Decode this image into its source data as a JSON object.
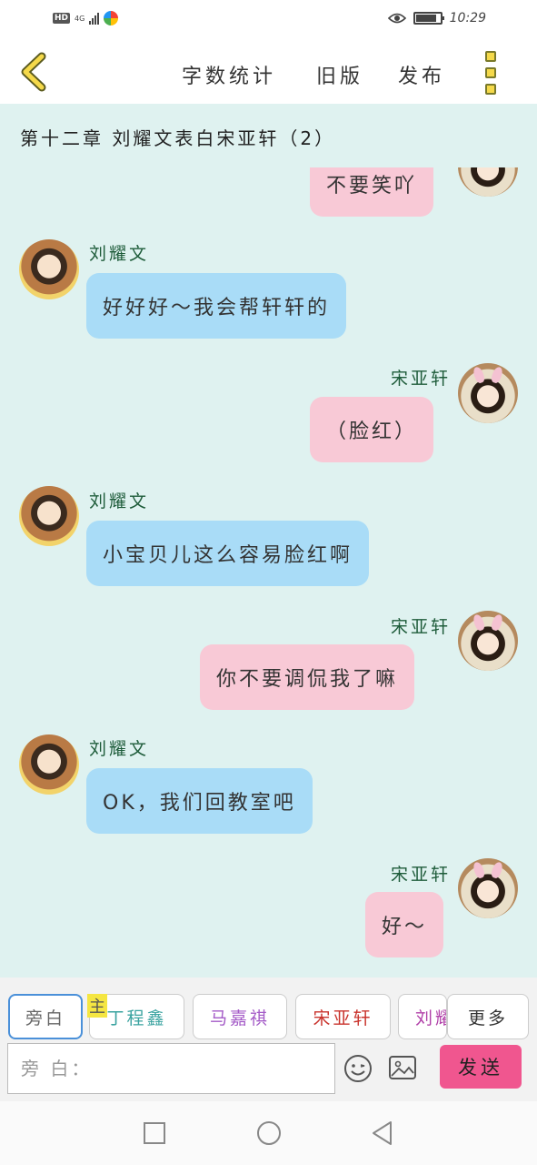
{
  "status_bar": {
    "hd": "HD",
    "network": "4G",
    "time": "10:29"
  },
  "toolbar": {
    "word_count": "字数统计",
    "old_version": "旧版",
    "publish": "发布"
  },
  "chapter": {
    "title": "第十二章  刘耀文表白宋亚轩（2）"
  },
  "messages": [
    {
      "side": "right",
      "sender": "",
      "text": "不要笑吖",
      "color": "pink"
    },
    {
      "side": "left",
      "sender": "刘耀文",
      "text": "好好好～我会帮轩轩的",
      "color": "blue"
    },
    {
      "side": "right",
      "sender": "宋亚轩",
      "text": "（脸红）",
      "color": "pink"
    },
    {
      "side": "left",
      "sender": "刘耀文",
      "text": "小宝贝儿这么容易脸红啊",
      "color": "blue"
    },
    {
      "side": "right",
      "sender": "宋亚轩",
      "text": "你不要调侃我了嘛",
      "color": "pink"
    },
    {
      "side": "left",
      "sender": "刘耀文",
      "text": "OK，我们回教室吧",
      "color": "blue"
    },
    {
      "side": "right",
      "sender": "宋亚轩",
      "text": "好～",
      "color": "pink"
    }
  ],
  "roles": {
    "narrator": "旁白",
    "main_tag": "主",
    "items": [
      {
        "label": "丁程鑫",
        "color": "#3aa3a0"
      },
      {
        "label": "马嘉祺",
        "color": "#a45bc7"
      },
      {
        "label": "宋亚轩",
        "color": "#c9332c"
      },
      {
        "label": "刘耀文",
        "color": "#b03fa8"
      }
    ],
    "more": "更多"
  },
  "input": {
    "placeholder": "旁 白：",
    "send": "发送"
  },
  "colors": {
    "chat_bg": "#dff2f0",
    "bubble_blue": "#a9dcf7",
    "bubble_pink": "#f8c9d6",
    "send_button": "#f0568f",
    "sender_name": "#1e5c3a"
  }
}
